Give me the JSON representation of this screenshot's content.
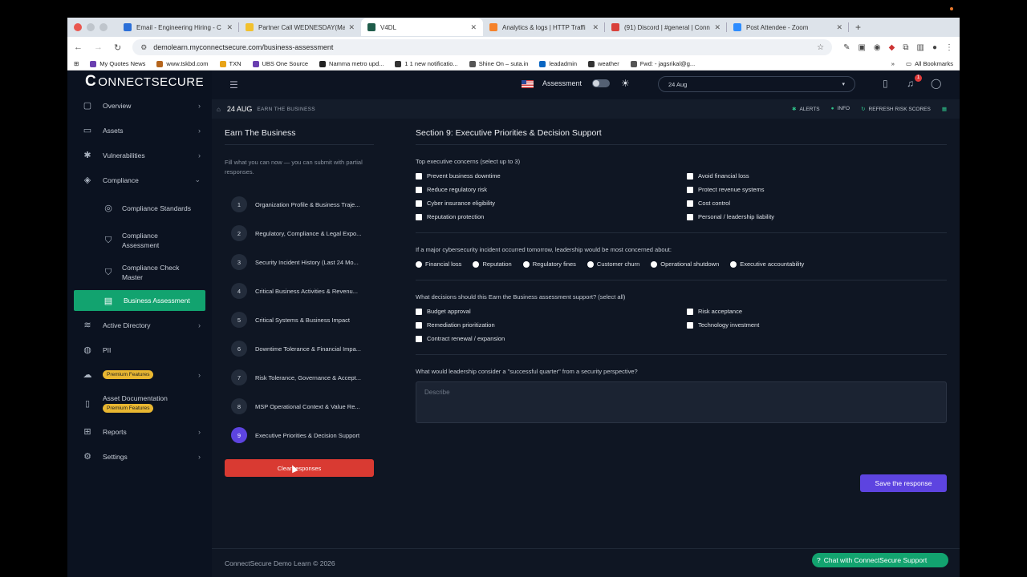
{
  "browser": {
    "tabs": [
      {
        "title": "Email - Engineering Hiring - C",
        "color": "#2b6fd8"
      },
      {
        "title": "Partner Call WEDNESDAY(Ma",
        "color": "#f2c12e"
      },
      {
        "title": "V4DL",
        "color": "#1f5c4a"
      },
      {
        "title": "Analytics & logs | HTTP Traffi",
        "color": "#f5822a"
      },
      {
        "title": "(91) Discord | #general | Conn",
        "color": "#d9413b"
      },
      {
        "title": "Post Attendee - Zoom",
        "color": "#2d8cff"
      }
    ],
    "url": "demolearn.myconnectsecure.com/business-assessment",
    "bookmarks": [
      "My Quotes News",
      "www.tskbd.com",
      "TXN",
      "UBS One Source",
      "Namma metro upd...",
      "1 1 new notificatio...",
      "Shine On – suta.in",
      "leadadmin",
      "weather",
      "Fwd: - jagsrikal@g..."
    ],
    "all_bookmarks": "All Bookmarks"
  },
  "sidebar": {
    "brand": "ONNECTSECURE",
    "brand_c": "C",
    "items": [
      {
        "label": "Overview",
        "icon": "▢",
        "chev": "›"
      },
      {
        "label": "Assets",
        "icon": "▭",
        "chev": "›"
      },
      {
        "label": "Vulnerabilities",
        "icon": "✱",
        "chev": "›"
      },
      {
        "label": "Compliance",
        "icon": "◈",
        "chev": "⌄"
      }
    ],
    "compliance_sub": [
      "Compliance Standards",
      "Compliance Assessment",
      "Compliance Check Master"
    ],
    "active_item": "Business Assessment",
    "lower": [
      {
        "label": "Active Directory",
        "icon": "≋",
        "chev": "›"
      },
      {
        "label": "PII",
        "icon": "◍",
        "chev": ""
      }
    ],
    "premium_badge": "Premium Features",
    "asset_doc": "Asset Documentation",
    "reports": "Reports",
    "settings": "Settings"
  },
  "topbar": {
    "assessment_label": "Assessment",
    "date_value": "24 Aug",
    "notification_count": "1"
  },
  "breadcrumb": {
    "date": "24 AUG",
    "page": "EARN THE BUSINESS",
    "alerts": "ALERTS",
    "info": "INFO",
    "refresh": "REFRESH RISK SCORES"
  },
  "steps_panel": {
    "title": "Earn The Business",
    "hint": "Fill what you can now — you can submit with partial responses.",
    "steps": [
      {
        "num": "1",
        "label": "Organization Profile & Business Traje..."
      },
      {
        "num": "2",
        "label": "Regulatory, Compliance & Legal Expo..."
      },
      {
        "num": "3",
        "label": "Security Incident History (Last 24 Mo..."
      },
      {
        "num": "4",
        "label": "Critical Business Activities & Revenu..."
      },
      {
        "num": "5",
        "label": "Critical Systems & Business Impact"
      },
      {
        "num": "6",
        "label": "Downtime Tolerance & Financial Impa..."
      },
      {
        "num": "7",
        "label": "Risk Tolerance, Governance & Accept..."
      },
      {
        "num": "8",
        "label": "MSP Operational Context & Value Re..."
      },
      {
        "num": "9",
        "label": "Executive Priorities & Decision Support"
      }
    ],
    "active_step": 9,
    "clear_label": "Clear responses"
  },
  "form": {
    "title": "Section 9: Executive Priorities & Decision Support",
    "q1": "Top executive concerns (select up to 3)",
    "q1_options": [
      "Prevent business downtime",
      "Avoid financial loss",
      "Reduce regulatory risk",
      "Protect revenue systems",
      "Cyber insurance eligibility",
      "Cost control",
      "Reputation protection",
      "Personal / leadership liability"
    ],
    "q2": "If a major cybersecurity incident occurred tomorrow, leadership would be most concerned about:",
    "q2_options": [
      "Financial loss",
      "Reputation",
      "Regulatory fines",
      "Customer churn",
      "Operational shutdown",
      "Executive accountability"
    ],
    "q3": "What decisions should this Earn the Business assessment support? (select all)",
    "q3_options": [
      "Budget approval",
      "Risk acceptance",
      "Remediation prioritization",
      "Technology investment",
      "Contract renewal / expansion"
    ],
    "q4": "What would leadership consider a \"successful quarter\" from a security perspective?",
    "q4_placeholder": "Describe",
    "save_label": "Save the response"
  },
  "footer": {
    "copyright": "ConnectSecure Demo Learn © 2026",
    "chat_label": "Chat with ConnectSecure Support"
  }
}
